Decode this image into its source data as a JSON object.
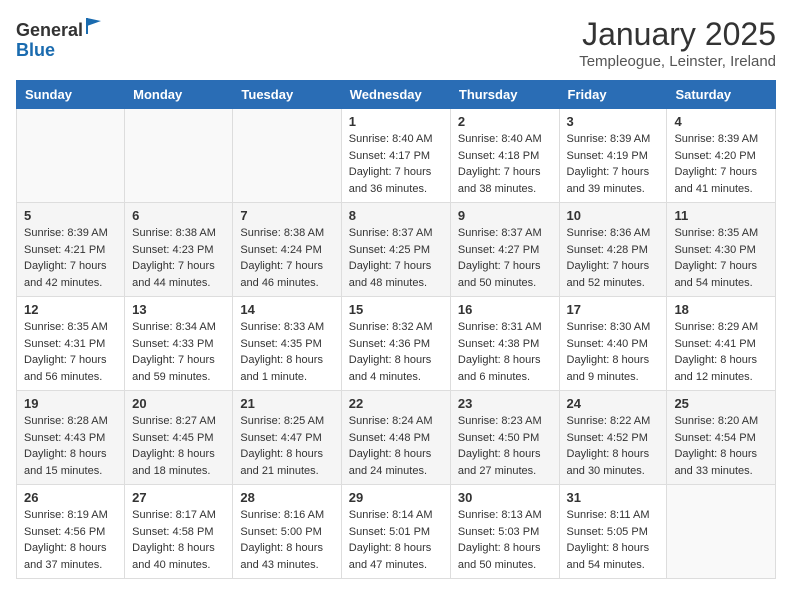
{
  "logo": {
    "general": "General",
    "blue": "Blue"
  },
  "header": {
    "month": "January 2025",
    "location": "Templeogue, Leinster, Ireland"
  },
  "weekdays": [
    "Sunday",
    "Monday",
    "Tuesday",
    "Wednesday",
    "Thursday",
    "Friday",
    "Saturday"
  ],
  "weeks": [
    [
      {
        "day": "",
        "sunrise": "",
        "sunset": "",
        "daylight": ""
      },
      {
        "day": "",
        "sunrise": "",
        "sunset": "",
        "daylight": ""
      },
      {
        "day": "",
        "sunrise": "",
        "sunset": "",
        "daylight": ""
      },
      {
        "day": "1",
        "sunrise": "Sunrise: 8:40 AM",
        "sunset": "Sunset: 4:17 PM",
        "daylight": "Daylight: 7 hours and 36 minutes."
      },
      {
        "day": "2",
        "sunrise": "Sunrise: 8:40 AM",
        "sunset": "Sunset: 4:18 PM",
        "daylight": "Daylight: 7 hours and 38 minutes."
      },
      {
        "day": "3",
        "sunrise": "Sunrise: 8:39 AM",
        "sunset": "Sunset: 4:19 PM",
        "daylight": "Daylight: 7 hours and 39 minutes."
      },
      {
        "day": "4",
        "sunrise": "Sunrise: 8:39 AM",
        "sunset": "Sunset: 4:20 PM",
        "daylight": "Daylight: 7 hours and 41 minutes."
      }
    ],
    [
      {
        "day": "5",
        "sunrise": "Sunrise: 8:39 AM",
        "sunset": "Sunset: 4:21 PM",
        "daylight": "Daylight: 7 hours and 42 minutes."
      },
      {
        "day": "6",
        "sunrise": "Sunrise: 8:38 AM",
        "sunset": "Sunset: 4:23 PM",
        "daylight": "Daylight: 7 hours and 44 minutes."
      },
      {
        "day": "7",
        "sunrise": "Sunrise: 8:38 AM",
        "sunset": "Sunset: 4:24 PM",
        "daylight": "Daylight: 7 hours and 46 minutes."
      },
      {
        "day": "8",
        "sunrise": "Sunrise: 8:37 AM",
        "sunset": "Sunset: 4:25 PM",
        "daylight": "Daylight: 7 hours and 48 minutes."
      },
      {
        "day": "9",
        "sunrise": "Sunrise: 8:37 AM",
        "sunset": "Sunset: 4:27 PM",
        "daylight": "Daylight: 7 hours and 50 minutes."
      },
      {
        "day": "10",
        "sunrise": "Sunrise: 8:36 AM",
        "sunset": "Sunset: 4:28 PM",
        "daylight": "Daylight: 7 hours and 52 minutes."
      },
      {
        "day": "11",
        "sunrise": "Sunrise: 8:35 AM",
        "sunset": "Sunset: 4:30 PM",
        "daylight": "Daylight: 7 hours and 54 minutes."
      }
    ],
    [
      {
        "day": "12",
        "sunrise": "Sunrise: 8:35 AM",
        "sunset": "Sunset: 4:31 PM",
        "daylight": "Daylight: 7 hours and 56 minutes."
      },
      {
        "day": "13",
        "sunrise": "Sunrise: 8:34 AM",
        "sunset": "Sunset: 4:33 PM",
        "daylight": "Daylight: 7 hours and 59 minutes."
      },
      {
        "day": "14",
        "sunrise": "Sunrise: 8:33 AM",
        "sunset": "Sunset: 4:35 PM",
        "daylight": "Daylight: 8 hours and 1 minute."
      },
      {
        "day": "15",
        "sunrise": "Sunrise: 8:32 AM",
        "sunset": "Sunset: 4:36 PM",
        "daylight": "Daylight: 8 hours and 4 minutes."
      },
      {
        "day": "16",
        "sunrise": "Sunrise: 8:31 AM",
        "sunset": "Sunset: 4:38 PM",
        "daylight": "Daylight: 8 hours and 6 minutes."
      },
      {
        "day": "17",
        "sunrise": "Sunrise: 8:30 AM",
        "sunset": "Sunset: 4:40 PM",
        "daylight": "Daylight: 8 hours and 9 minutes."
      },
      {
        "day": "18",
        "sunrise": "Sunrise: 8:29 AM",
        "sunset": "Sunset: 4:41 PM",
        "daylight": "Daylight: 8 hours and 12 minutes."
      }
    ],
    [
      {
        "day": "19",
        "sunrise": "Sunrise: 8:28 AM",
        "sunset": "Sunset: 4:43 PM",
        "daylight": "Daylight: 8 hours and 15 minutes."
      },
      {
        "day": "20",
        "sunrise": "Sunrise: 8:27 AM",
        "sunset": "Sunset: 4:45 PM",
        "daylight": "Daylight: 8 hours and 18 minutes."
      },
      {
        "day": "21",
        "sunrise": "Sunrise: 8:25 AM",
        "sunset": "Sunset: 4:47 PM",
        "daylight": "Daylight: 8 hours and 21 minutes."
      },
      {
        "day": "22",
        "sunrise": "Sunrise: 8:24 AM",
        "sunset": "Sunset: 4:48 PM",
        "daylight": "Daylight: 8 hours and 24 minutes."
      },
      {
        "day": "23",
        "sunrise": "Sunrise: 8:23 AM",
        "sunset": "Sunset: 4:50 PM",
        "daylight": "Daylight: 8 hours and 27 minutes."
      },
      {
        "day": "24",
        "sunrise": "Sunrise: 8:22 AM",
        "sunset": "Sunset: 4:52 PM",
        "daylight": "Daylight: 8 hours and 30 minutes."
      },
      {
        "day": "25",
        "sunrise": "Sunrise: 8:20 AM",
        "sunset": "Sunset: 4:54 PM",
        "daylight": "Daylight: 8 hours and 33 minutes."
      }
    ],
    [
      {
        "day": "26",
        "sunrise": "Sunrise: 8:19 AM",
        "sunset": "Sunset: 4:56 PM",
        "daylight": "Daylight: 8 hours and 37 minutes."
      },
      {
        "day": "27",
        "sunrise": "Sunrise: 8:17 AM",
        "sunset": "Sunset: 4:58 PM",
        "daylight": "Daylight: 8 hours and 40 minutes."
      },
      {
        "day": "28",
        "sunrise": "Sunrise: 8:16 AM",
        "sunset": "Sunset: 5:00 PM",
        "daylight": "Daylight: 8 hours and 43 minutes."
      },
      {
        "day": "29",
        "sunrise": "Sunrise: 8:14 AM",
        "sunset": "Sunset: 5:01 PM",
        "daylight": "Daylight: 8 hours and 47 minutes."
      },
      {
        "day": "30",
        "sunrise": "Sunrise: 8:13 AM",
        "sunset": "Sunset: 5:03 PM",
        "daylight": "Daylight: 8 hours and 50 minutes."
      },
      {
        "day": "31",
        "sunrise": "Sunrise: 8:11 AM",
        "sunset": "Sunset: 5:05 PM",
        "daylight": "Daylight: 8 hours and 54 minutes."
      },
      {
        "day": "",
        "sunrise": "",
        "sunset": "",
        "daylight": ""
      }
    ]
  ]
}
